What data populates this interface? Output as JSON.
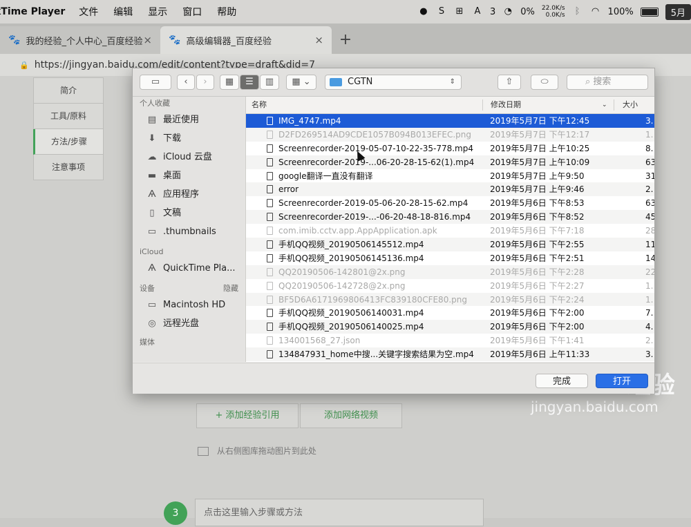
{
  "menubar": {
    "app_name": "kTime Player",
    "menus": [
      "文件",
      "编辑",
      "显示",
      "窗口",
      "帮助"
    ],
    "status_number": "3",
    "cpu": "0%",
    "net_up": "22.0K/s",
    "net_down": "0.0K/s",
    "battery": "100%",
    "clock": "5月"
  },
  "tabs": [
    {
      "title": "我的经验_个人中心_百度经验"
    },
    {
      "title": "高级编辑器_百度经验"
    }
  ],
  "newtab_label": "+",
  "tab_close": "×",
  "url": "https://jingyan.baidu.com/edit/content?type=draft&did=7",
  "page": {
    "sidenav": [
      "简介",
      "工具/原料",
      "方法/步骤",
      "注意事项"
    ],
    "btn_add_ref": "+ 添加经验引用",
    "btn_add_video": "添加网络视频",
    "drag_hint": "从右侧图库拖动图片到此处",
    "step_number": "3",
    "step_placeholder": "点击这里输入步骤或方法"
  },
  "watermark": {
    "logo": "Bai du 经验",
    "url": "jingyan.baidu.com"
  },
  "dialog": {
    "folder": "CGTN",
    "search_placeholder": "搜索",
    "sidebar": {
      "favorites_header": "个人收藏",
      "favorites": [
        {
          "label": "最近使用",
          "icon": "recent-icon"
        },
        {
          "label": "下载",
          "icon": "download-icon"
        },
        {
          "label": "iCloud 云盘",
          "icon": "cloud-icon"
        },
        {
          "label": "桌面",
          "icon": "desktop-icon"
        },
        {
          "label": "应用程序",
          "icon": "applications-icon"
        },
        {
          "label": "文稿",
          "icon": "documents-icon"
        },
        {
          "label": ".thumbnails",
          "icon": "folder-icon"
        }
      ],
      "icloud_header": "iCloud",
      "icloud": [
        {
          "label": "QuickTime Pla...",
          "icon": "quicktime-icon"
        }
      ],
      "devices_header": "设备",
      "devices_hide": "隐藏",
      "devices": [
        {
          "label": "Macintosh HD",
          "icon": "disk-icon"
        },
        {
          "label": "远程光盘",
          "icon": "disc-icon"
        }
      ],
      "media_header": "媒体"
    },
    "columns": {
      "name": "名称",
      "date": "修改日期",
      "size": "大小"
    },
    "files": [
      {
        "name": "IMG_4747.mp4",
        "date": "2019年5月7日 下午12:45",
        "size": "3.",
        "state": "selected"
      },
      {
        "name": "D2FD269514AD9CDE1057B094B013EFEC.png",
        "date": "2019年5月7日 下午12:17",
        "size": "1.",
        "state": "dim"
      },
      {
        "name": "Screenrecorder-2019-05-07-10-22-35-778.mp4",
        "date": "2019年5月7日 上午10:25",
        "size": "8.",
        "state": "normal"
      },
      {
        "name": "Screenrecorder-2019-...06-20-28-15-62(1).mp4",
        "date": "2019年5月7日 上午10:09",
        "size": "63.",
        "state": "normal"
      },
      {
        "name": "google翻译一直没有翻译",
        "date": "2019年5月7日 上午9:50",
        "size": "31.",
        "state": "normal"
      },
      {
        "name": "error",
        "date": "2019年5月7日 上午9:46",
        "size": "2.",
        "state": "normal"
      },
      {
        "name": "Screenrecorder-2019-05-06-20-28-15-62.mp4",
        "date": "2019年5月6日 下午8:53",
        "size": "63.",
        "state": "normal"
      },
      {
        "name": "Screenrecorder-2019-...-06-20-48-18-816.mp4",
        "date": "2019年5月6日 下午8:52",
        "size": "45.",
        "state": "normal"
      },
      {
        "name": "com.imib.cctv.app.AppApplication.apk",
        "date": "2019年5月6日 下午7:18",
        "size": "28.",
        "state": "dim"
      },
      {
        "name": "手机QQ视频_20190506145512.mp4",
        "date": "2019年5月6日 下午2:55",
        "size": "11.",
        "state": "normal"
      },
      {
        "name": "手机QQ视频_20190506145136.mp4",
        "date": "2019年5月6日 下午2:51",
        "size": "14.",
        "state": "normal"
      },
      {
        "name": "QQ20190506-142801@2x.png",
        "date": "2019年5月6日 下午2:28",
        "size": "22",
        "state": "dim"
      },
      {
        "name": "QQ20190506-142728@2x.png",
        "date": "2019年5月6日 下午2:27",
        "size": "1.",
        "state": "dim"
      },
      {
        "name": "BF5D6A6171969806413FC839180CFE80.png",
        "date": "2019年5月6日 下午2:24",
        "size": "1.",
        "state": "dim"
      },
      {
        "name": "手机QQ视频_20190506140031.mp4",
        "date": "2019年5月6日 下午2:00",
        "size": "7.",
        "state": "normal"
      },
      {
        "name": "手机QQ视频_20190506140025.mp4",
        "date": "2019年5月6日 下午2:00",
        "size": "4.",
        "state": "normal"
      },
      {
        "name": "134001568_27.json",
        "date": "2019年5月6日 下午1:41",
        "size": "2.",
        "state": "dim"
      },
      {
        "name": "134847931_home中搜...关键字搜索结果为空.mp4",
        "date": "2019年5月6日 上午11:33",
        "size": "3.",
        "state": "normal"
      }
    ],
    "btn_done": "完成",
    "btn_open": "打开"
  }
}
